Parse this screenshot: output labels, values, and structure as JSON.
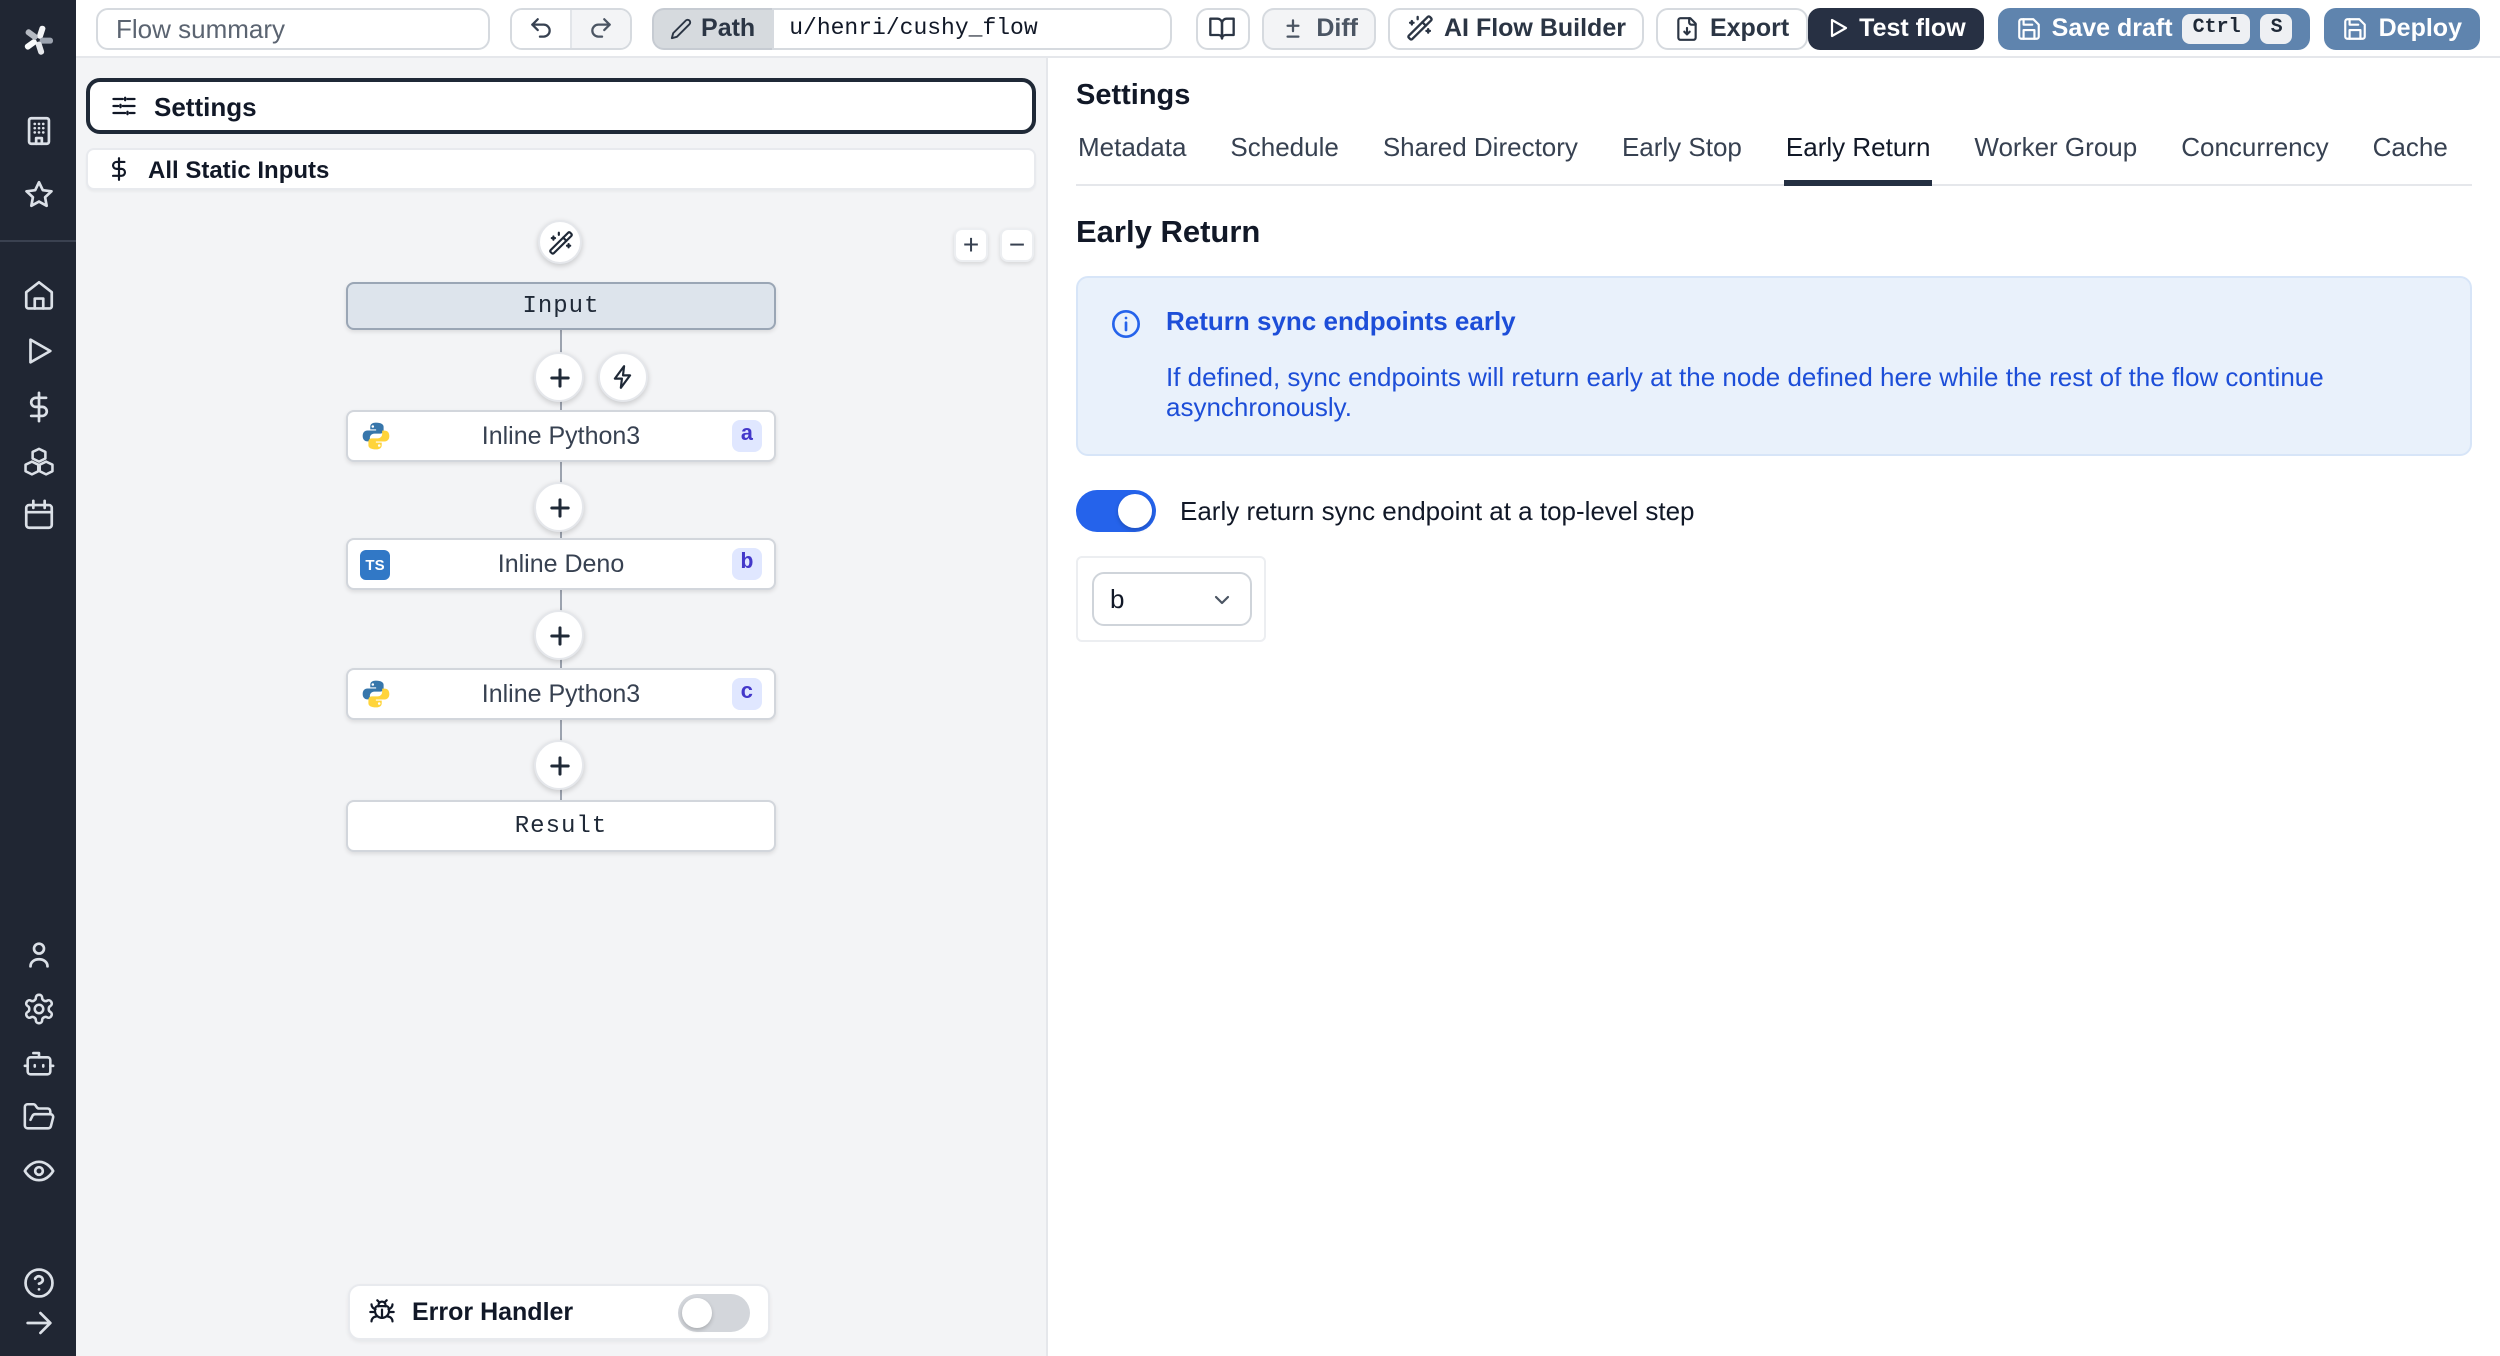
{
  "app": {
    "name": "Windmill flow editor"
  },
  "colors": {
    "sidebar_bg": "#202633",
    "accent_blue": "#5f84ae",
    "dark_button": "#273043",
    "toggle_on": "#2563eb",
    "info_bg": "#e9f1fb",
    "info_text": "#1d4ed8",
    "badge_bg": "#e0e7ff",
    "badge_text": "#4338ca",
    "input_node_bg": "#dde4ec",
    "python_blue": "#3776ab",
    "python_yellow": "#ffd43b",
    "typescript_blue": "#3178c6"
  },
  "sidebar": {
    "icons": [
      "windmill-logo",
      "building",
      "star",
      "home",
      "play",
      "dollar",
      "boxes",
      "calendar",
      "user",
      "gear",
      "robot",
      "folder-open",
      "eye",
      "help",
      "arrow-right"
    ]
  },
  "toolbar": {
    "flow_summary_placeholder": "Flow summary",
    "path_label": "Path",
    "path_value": "u/henri/cushy_flow",
    "diff_label": "Diff",
    "ai_flow_builder_label": "AI Flow Builder",
    "export_label": "Export",
    "test_flow_label": "Test flow",
    "save_draft_label": "Save draft",
    "kbd_ctrl": "Ctrl",
    "kbd_s": "S",
    "deploy_label": "Deploy"
  },
  "flow": {
    "settings_label": "Settings",
    "all_static_inputs_label": "All Static Inputs",
    "zoom_in_label": "+",
    "zoom_out_label": "−",
    "ts_label": "TS",
    "nodes": {
      "input": {
        "label": "Input"
      },
      "a": {
        "label": "Inline Python3",
        "badge": "a",
        "language": "python3"
      },
      "b": {
        "label": "Inline Deno",
        "badge": "b",
        "language": "deno"
      },
      "c": {
        "label": "Inline Python3",
        "badge": "c",
        "language": "python3"
      },
      "result": {
        "label": "Result"
      }
    },
    "error_handler_label": "Error Handler",
    "error_handler_enabled": false
  },
  "settings": {
    "title": "Settings",
    "tabs": [
      {
        "label": "Metadata",
        "active": false
      },
      {
        "label": "Schedule",
        "active": false
      },
      {
        "label": "Shared Directory",
        "active": false
      },
      {
        "label": "Early Stop",
        "active": false
      },
      {
        "label": "Early Return",
        "active": true
      },
      {
        "label": "Worker Group",
        "active": false
      },
      {
        "label": "Concurrency",
        "active": false
      },
      {
        "label": "Cache",
        "active": false
      }
    ],
    "section_title": "Early Return",
    "info_title": "Return sync endpoints early",
    "info_body": "If defined, sync endpoints will return early at the node defined here while the rest of the flow continue asynchronously.",
    "toggle_label": "Early return sync endpoint at a top-level step",
    "toggle_on": true,
    "step_select_value": "b"
  }
}
